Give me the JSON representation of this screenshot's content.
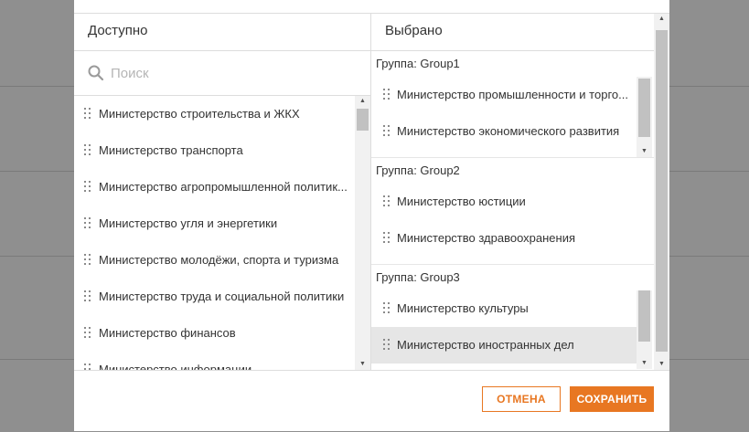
{
  "dialog": {
    "available": {
      "header": "Доступно",
      "search_placeholder": "Поиск",
      "items": [
        "Министерство строительства и ЖКХ",
        "Министерство транспорта",
        "Министерство агропромышленной политик...",
        "Министерство угля и энергетики",
        "Министерство молодёжи, спорта и туризма",
        "Министерство труда и социальной политики",
        "Министерство финансов",
        "Министерство информации"
      ]
    },
    "selected": {
      "header": "Выбрано",
      "groups": [
        {
          "title": "Группа: Group1",
          "items": [
            "Министерство промышленности и торго...",
            "Министерство экономического развития"
          ]
        },
        {
          "title": "Группа: Group2",
          "items": [
            "Министерство юстиции",
            "Министерство здравоохранения"
          ]
        },
        {
          "title": "Группа: Group3",
          "items": [
            "Министерство культуры",
            "Министерство иностранных дел"
          ]
        }
      ]
    },
    "footer": {
      "cancel_label": "ОТМЕНА",
      "save_label": "СОХРАНИТЬ"
    }
  },
  "icons": {
    "search": "search-icon",
    "drag": "drag-handle-icon"
  },
  "colors": {
    "accent": "#e87722",
    "overlay": "#8f8f8f",
    "selected_row": "#e6e6e6"
  }
}
